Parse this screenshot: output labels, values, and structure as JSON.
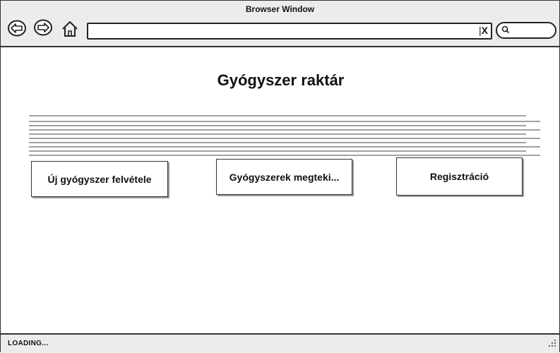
{
  "window": {
    "title": "Browser Window"
  },
  "toolbar": {
    "back_icon": "back-arrow-icon",
    "forward_icon": "forward-arrow-icon",
    "home_icon": "home-icon",
    "url_value": "",
    "clear_label": "X",
    "search_value": ""
  },
  "page": {
    "title": "Gyógyszer raktár",
    "buttons": {
      "add_medicine": "Új gyógyszer felvétele",
      "view_medicines": "Gyógyszerek megteki...",
      "register": "Regisztráció"
    }
  },
  "statusbar": {
    "text": "LOADING..."
  }
}
